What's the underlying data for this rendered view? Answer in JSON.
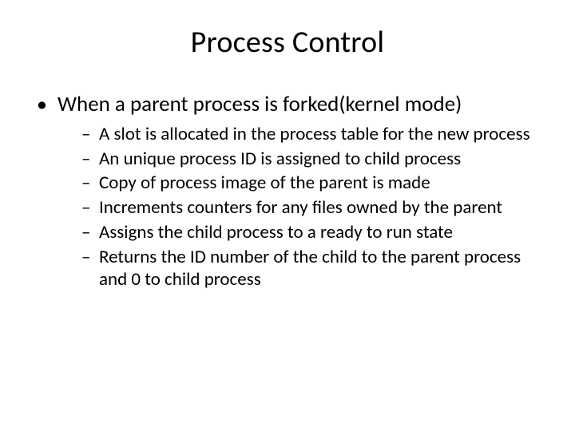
{
  "title": "Process Control",
  "bullet1": "When a parent process is forked(kernel mode)",
  "sub": {
    "s1": "A slot is allocated in the process table for the new process",
    "s2": "An unique process ID is assigned to child process",
    "s3": "Copy of process image of the parent is made",
    "s4": "Increments counters for any files owned by the parent",
    "s5": "Assigns the child process to a ready to run state",
    "s6": "Returns the ID number of the child to the parent process and 0 to child process"
  }
}
